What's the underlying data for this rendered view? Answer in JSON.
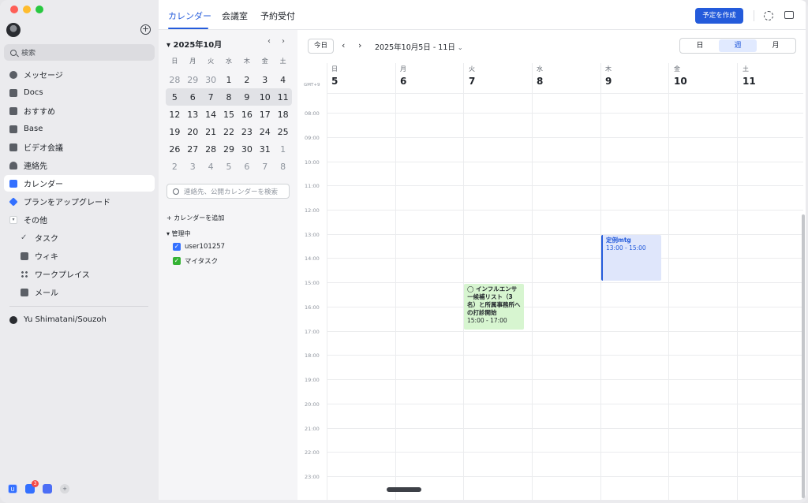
{
  "sidebar": {
    "search_label": "検索",
    "items": [
      {
        "label": "メッセージ",
        "icon": "chat-icon"
      },
      {
        "label": "Docs",
        "icon": "docs-icon"
      },
      {
        "label": "おすすめ",
        "icon": "recommend-icon"
      },
      {
        "label": "Base",
        "icon": "base-icon"
      },
      {
        "label": "ビデオ会議",
        "icon": "video-icon"
      },
      {
        "label": "連絡先",
        "icon": "contacts-icon"
      },
      {
        "label": "カレンダー",
        "icon": "calendar-icon"
      },
      {
        "label": "プランをアップグレード",
        "icon": "diamond-icon"
      },
      {
        "label": "その他",
        "icon": "more-icon"
      },
      {
        "label": "タスク",
        "icon": "task-icon"
      },
      {
        "label": "ウィキ",
        "icon": "wiki-icon"
      },
      {
        "label": "ワークプレイス",
        "icon": "workplace-icon"
      },
      {
        "label": "メール",
        "icon": "mail-icon"
      }
    ],
    "workspace": "Yu Shimatani/Souzoh",
    "badge_count": "3"
  },
  "header": {
    "tabs": [
      "カレンダー",
      "会議室",
      "予約受付"
    ],
    "create_button": "予定を作成"
  },
  "mini_calendar": {
    "month": "2025年10月",
    "prev": "‹",
    "next": "›",
    "weekdays": [
      "日",
      "月",
      "火",
      "水",
      "木",
      "金",
      "土"
    ],
    "weeks": [
      [
        "28",
        "29",
        "30",
        "1",
        "2",
        "3",
        "4"
      ],
      [
        "5",
        "6",
        "7",
        "8",
        "9",
        "10",
        "11"
      ],
      [
        "12",
        "13",
        "14",
        "15",
        "16",
        "17",
        "18"
      ],
      [
        "19",
        "20",
        "21",
        "22",
        "23",
        "24",
        "25"
      ],
      [
        "26",
        "27",
        "28",
        "29",
        "30",
        "31",
        "1"
      ],
      [
        "2",
        "3",
        "4",
        "5",
        "6",
        "7",
        "8"
      ]
    ],
    "search_placeholder": "連絡先、公開カレンダーを検索",
    "add_calendar": "+ カレンダーを追加",
    "managed_label": "▾ 管理中",
    "calendars": [
      {
        "name": "user101257",
        "color": "#3370ff"
      },
      {
        "name": "マイタスク",
        "color": "#34b233"
      }
    ]
  },
  "week_view": {
    "today_button": "今日",
    "range": "2025年10月5日 - 11日",
    "views": [
      "日",
      "週",
      "月"
    ],
    "active_view": "週",
    "timezone": "GMT+9",
    "days": [
      {
        "dow": "日",
        "date": "5"
      },
      {
        "dow": "月",
        "date": "6"
      },
      {
        "dow": "火",
        "date": "7"
      },
      {
        "dow": "水",
        "date": "8"
      },
      {
        "dow": "木",
        "date": "9"
      },
      {
        "dow": "金",
        "date": "10"
      },
      {
        "dow": "土",
        "date": "11"
      }
    ],
    "hours": [
      "08:00",
      "09:00",
      "10:00",
      "11:00",
      "12:00",
      "13:00",
      "14:00",
      "15:00",
      "16:00",
      "17:00",
      "18:00",
      "19:00",
      "20:00",
      "21:00",
      "22:00",
      "23:00"
    ],
    "events": [
      {
        "title": "定例mtg",
        "time": "13:00 - 15:00",
        "day": "木"
      },
      {
        "title": "◯ インフルエンサー候補リスト（3名）と所属事務所への打診開始",
        "time": "15:00 - 17:00",
        "day": "火"
      }
    ]
  }
}
